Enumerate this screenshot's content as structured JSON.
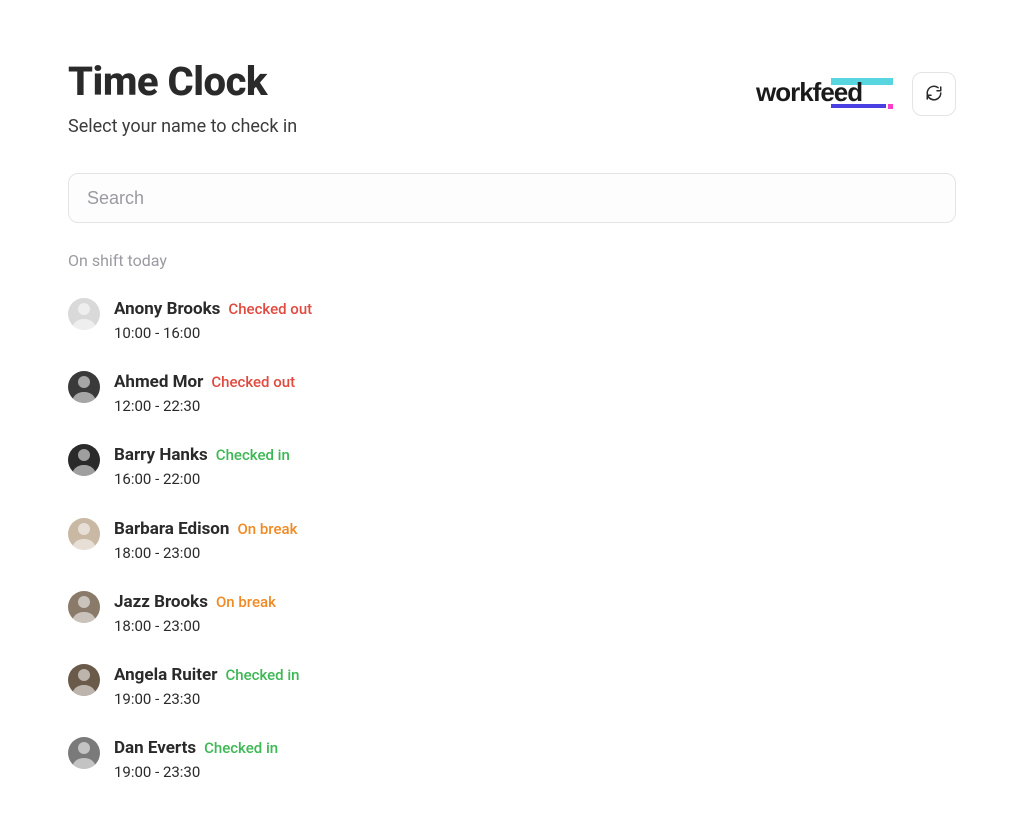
{
  "header": {
    "title": "Time Clock",
    "subtitle": "Select your name to check in",
    "brand": "workfeed"
  },
  "search": {
    "placeholder": "Search",
    "value": ""
  },
  "section_label": "On shift today",
  "status_colors": {
    "checked_out": "#e04a3f",
    "checked_in": "#3cb854",
    "on_break": "#f08a24"
  },
  "shift_list": [
    {
      "name": "Anony Brooks",
      "status_text": "Checked out",
      "status_kind": "checked-out",
      "shift": "10:00 - 16:00",
      "avatar_bg": "#d9d9d9"
    },
    {
      "name": "Ahmed Mor",
      "status_text": "Checked out",
      "status_kind": "checked-out",
      "shift": "12:00 - 22:30",
      "avatar_bg": "#3a3a3a"
    },
    {
      "name": "Barry Hanks",
      "status_text": "Checked in",
      "status_kind": "checked-in",
      "shift": "16:00 - 22:00",
      "avatar_bg": "#2a2a2a"
    },
    {
      "name": "Barbara Edison",
      "status_text": "On break",
      "status_kind": "on-break",
      "shift": "18:00 - 23:00",
      "avatar_bg": "#c9b8a3"
    },
    {
      "name": "Jazz Brooks",
      "status_text": "On break",
      "status_kind": "on-break",
      "shift": "18:00 - 23:00",
      "avatar_bg": "#8a7a6a"
    },
    {
      "name": "Angela Ruiter",
      "status_text": "Checked in",
      "status_kind": "checked-in",
      "shift": "19:00 - 23:30",
      "avatar_bg": "#6a5a4a"
    },
    {
      "name": "Dan Everts",
      "status_text": "Checked in",
      "status_kind": "checked-in",
      "shift": "19:00 - 23:30",
      "avatar_bg": "#7a7a7a"
    }
  ]
}
